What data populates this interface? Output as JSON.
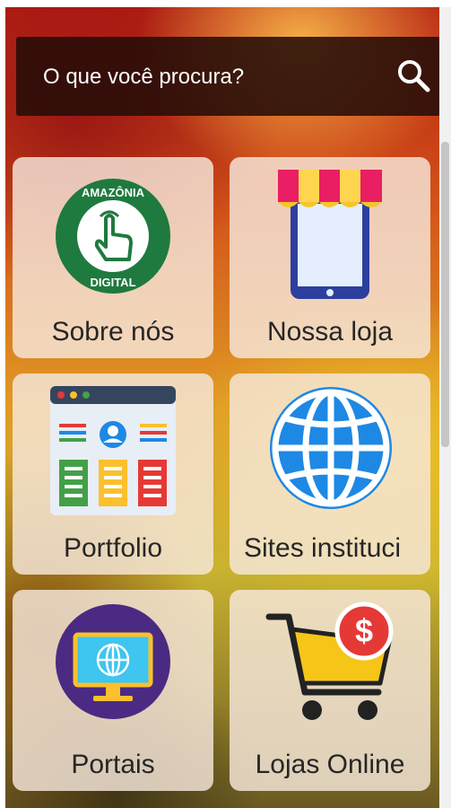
{
  "search": {
    "placeholder": "O que você procura?",
    "icon": "search-icon"
  },
  "cards": [
    {
      "label": "Sobre nós",
      "icon": "amazonia-digital-logo-icon",
      "logo_top": "AMAZÔNIA",
      "logo_bottom": "DIGITAL"
    },
    {
      "label": "Nossa loja",
      "icon": "storefront-phone-icon"
    },
    {
      "label": "Portfolio",
      "icon": "portfolio-dashboard-icon"
    },
    {
      "label": "Sites instituci",
      "icon": "globe-icon"
    },
    {
      "label": "Portais",
      "icon": "monitor-globe-icon"
    },
    {
      "label": "Lojas Online",
      "icon": "shopping-cart-dollar-icon",
      "badge": "$"
    }
  ],
  "colors": {
    "search_bg": "#260c08",
    "card_bg": "#f6e8dc",
    "logo_green": "#1f7a3f",
    "globe_blue": "#1e88e5",
    "portal_purple": "#4b2a83",
    "cart_yellow": "#f5c518",
    "dollar_red": "#e53935"
  }
}
